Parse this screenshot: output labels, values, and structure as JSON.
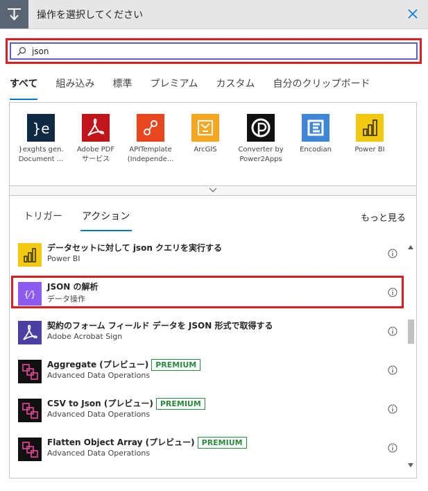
{
  "header": {
    "title": "操作を選択してください"
  },
  "search": {
    "value": "json"
  },
  "tabs": [
    {
      "label": "すべて"
    },
    {
      "label": "組み込み"
    },
    {
      "label": "標準"
    },
    {
      "label": "プレミアム"
    },
    {
      "label": "カスタム"
    },
    {
      "label": "自分のクリップボード"
    }
  ],
  "connectors": [
    {
      "line1": "}exghts gen.",
      "line2": "Document ...",
      "icon": "jexghts-icon",
      "color": "#102a43"
    },
    {
      "line1": "Adobe PDF",
      "line2": "サービス",
      "icon": "adobe-pdf-icon",
      "color": "#c0151b"
    },
    {
      "line1": "APITemplate",
      "line2": "(Independe...",
      "icon": "apitemplate-icon",
      "color": "#e8461e"
    },
    {
      "line1": "ArcGIS",
      "line2": "",
      "icon": "arcgis-icon",
      "color": "#f5a623"
    },
    {
      "line1": "Converter by",
      "line2": "Power2Apps",
      "icon": "converter-icon",
      "color": "#111111"
    },
    {
      "line1": "Encodian",
      "line2": "",
      "icon": "encodian-icon",
      "color": "#3e86d8"
    },
    {
      "line1": "Power BI",
      "line2": "",
      "icon": "power-bi-icon",
      "color": "#f2c811"
    }
  ],
  "subtabs": [
    {
      "label": "トリガー"
    },
    {
      "label": "アクション"
    }
  ],
  "more": "もっと見る",
  "actions": [
    {
      "title": "データセットに対して json クエリを実行する",
      "subtitle": "Power BI",
      "premium": "",
      "icon": "power-bi-icon",
      "color": "#f2c811"
    },
    {
      "title": "JSON の解析",
      "subtitle": "データ操作",
      "premium": "",
      "icon": "data-operation-icon",
      "color": "#8c5cf0"
    },
    {
      "title": "契約のフォーム フィールド データを JSON 形式で取得する",
      "subtitle": "Adobe Acrobat Sign",
      "premium": "",
      "icon": "adobe-sign-icon",
      "color": "#4b3fa3"
    },
    {
      "title": "Aggregate (プレビュー)",
      "subtitle": "Advanced Data Operations",
      "premium": "PREMIUM",
      "icon": "advanced-data-operations-icon",
      "color": "#111111"
    },
    {
      "title": "CSV to Json (プレビュー)",
      "subtitle": "Advanced Data Operations",
      "premium": "PREMIUM",
      "icon": "advanced-data-operations-icon",
      "color": "#111111"
    },
    {
      "title": "Flatten Object Array (プレビュー)",
      "subtitle": "Advanced Data Operations",
      "premium": "PREMIUM",
      "icon": "advanced-data-operations-icon",
      "color": "#111111"
    }
  ]
}
